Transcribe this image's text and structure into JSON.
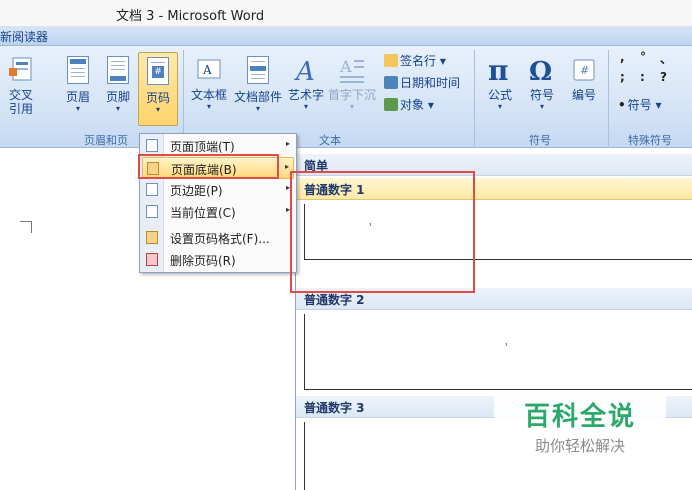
{
  "window": {
    "title": "文档 3 - Microsoft Word"
  },
  "tabstrip": {
    "active_tab": "新阅读器"
  },
  "ribbon": {
    "buttons": [
      {
        "label": "交叉\n引用",
        "line1": "交叉",
        "line2": "引用"
      },
      {
        "label": "页眉",
        "arrow": "▾"
      },
      {
        "label": "页脚",
        "arrow": "▾"
      },
      {
        "label": "页码",
        "arrow": "▾"
      },
      {
        "label": "文本框",
        "arrow": "▾"
      },
      {
        "label": "文档部件",
        "arrow": "▾"
      },
      {
        "label": "艺术字",
        "arrow": "▾"
      },
      {
        "label": "首字下沉",
        "arrow": "▾"
      },
      {
        "label": "公式",
        "arrow": "▾"
      },
      {
        "label": "符号",
        "arrow": "▾"
      },
      {
        "label": "编号"
      }
    ],
    "small_items": {
      "signature": "签名行 ▾",
      "datetime": "日期和时间",
      "object": "对象 ▾",
      "special_symbol": "符号 ▾"
    },
    "groups": {
      "header_footer": "页眉和页",
      "text": "文本",
      "symbols": "符号",
      "special_symbols": "特殊符号"
    },
    "punct_glyphs": [
      ",",
      "°",
      "、",
      ";",
      ":",
      "?",
      "•"
    ]
  },
  "menu": {
    "items": [
      {
        "label": "页面顶端(T)",
        "has_submenu": true
      },
      {
        "label": "页面底端(B)",
        "has_submenu": true
      },
      {
        "label": "页边距(P)",
        "has_submenu": true
      },
      {
        "label": "当前位置(C)",
        "has_submenu": true
      },
      {
        "label": "设置页码格式(F)..."
      },
      {
        "label": "删除页码(R)"
      }
    ],
    "submenu_arrow": "▸"
  },
  "gallery": {
    "section": "简单",
    "items": [
      {
        "title": "普通数字 1",
        "sample": "¹"
      },
      {
        "title": "普通数字 2",
        "sample": "¹"
      },
      {
        "title": "普通数字 3"
      }
    ]
  },
  "watermark": {
    "line1": "百科全说",
    "line2": "助你轻松解决"
  },
  "colors": {
    "accent": "#15428b",
    "highlight": "#e24a4a",
    "watermark": "#2ca86a"
  }
}
